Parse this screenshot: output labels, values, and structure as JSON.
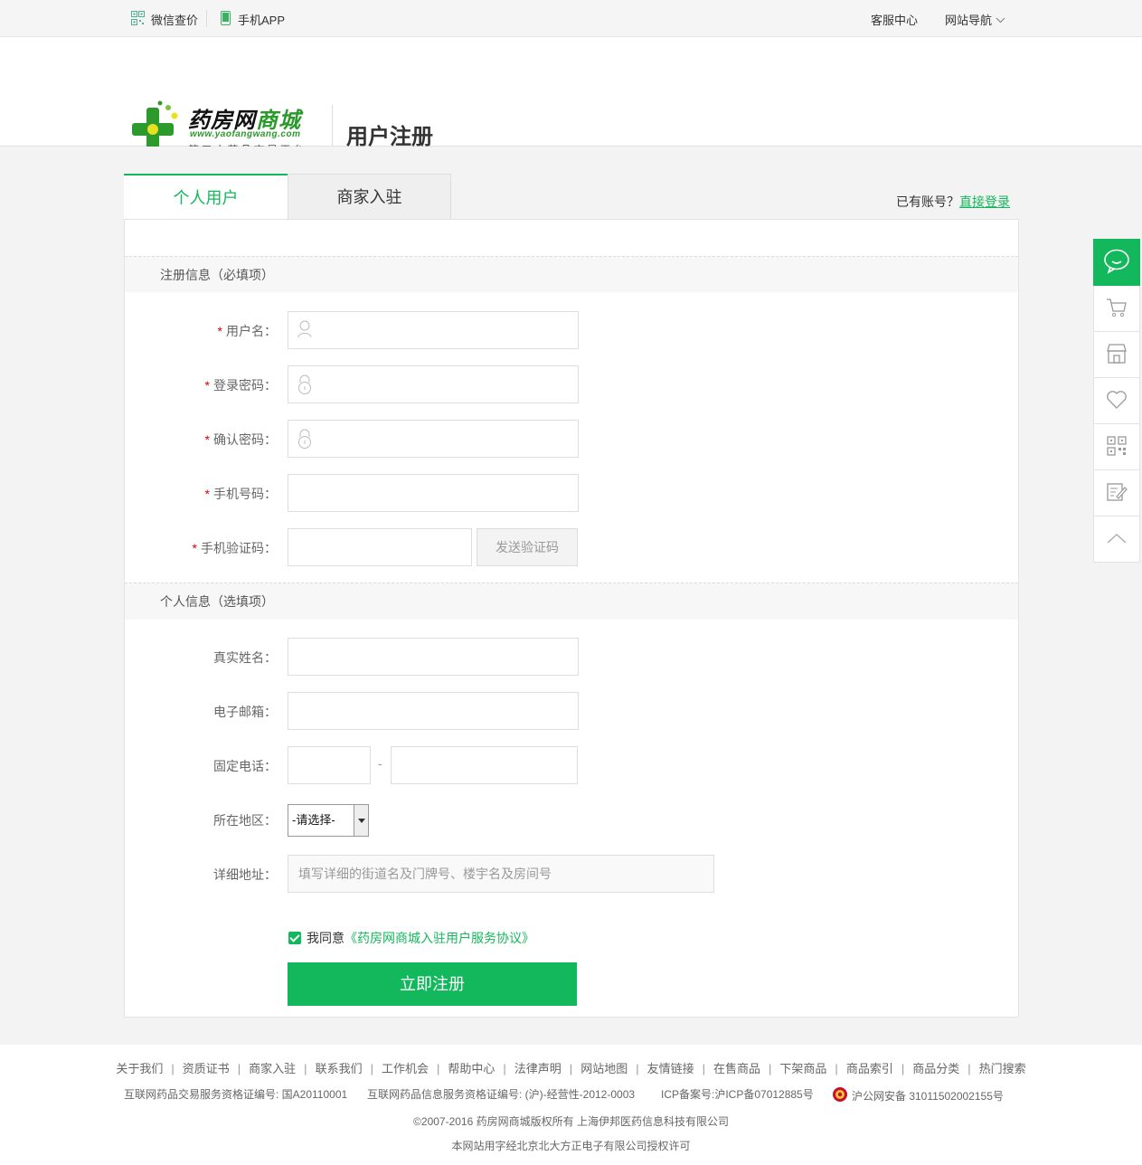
{
  "topbar": {
    "wechat_label": "微信查价",
    "app_label": "手机APP",
    "service_label": "客服中心",
    "nav_label": "网站导航"
  },
  "header": {
    "logo_name_black": "药房网",
    "logo_name_green": "商城",
    "logo_url": "www.yaofangwang.com",
    "logo_sub": "第三方药品交易平台",
    "title": "用户注册"
  },
  "tabs": {
    "personal": "个人用户",
    "merchant": "商家入驻"
  },
  "login_hint": {
    "text": "已有账号？",
    "link": "直接登录"
  },
  "required_section": {
    "title": "注册信息（必填项）",
    "star": "*",
    "username_label": "用户名：",
    "password_label": "登录密码：",
    "confirm_label": "确认密码：",
    "phone_label": "手机号码：",
    "code_label": "手机验证码：",
    "send_code": "发送验证码"
  },
  "optional_section": {
    "title": "个人信息（选填项）",
    "realname_label": "真实姓名：",
    "email_label": "电子邮箱：",
    "tel_label": "固定电话：",
    "tel_dash": "-",
    "region_label": "所在地区：",
    "region_value": "-请选择-",
    "address_label": "详细地址：",
    "address_placeholder": "填写详细的街道名及门牌号、楼宇名及房间号"
  },
  "agreement": {
    "checked": true,
    "prefix": "我同意",
    "link": "《药房网商城入驻用户服务协议》"
  },
  "submit_label": "立即注册",
  "sidebar_icons": [
    "chat-icon",
    "cart-icon",
    "shop-icon",
    "heart-icon",
    "qrcode-icon",
    "edit-icon",
    "back-to-top-icon"
  ],
  "footer": {
    "links": [
      "关于我们",
      "资质证书",
      "商家入驻",
      "联系我们",
      "工作机会",
      "帮助中心",
      "法律声明",
      "网站地图",
      "友情链接",
      "在售商品",
      "下架商品",
      "商品索引",
      "商品分类",
      "热门搜索"
    ],
    "license1": "互联网药品交易服务资格证编号: 国A20110001",
    "license2": "互联网药品信息服务资格证编号: (沪)-经营性-2012-0003",
    "icp": "ICP备案号:沪ICP备07012885号",
    "police": "沪公网安备 31011502002155号",
    "copyright": "©2007-2016 药房网商城版权所有 上海伊邦医药信息科技有限公司",
    "font_auth": "本网站用字经北京北大方正电子有限公司授权许可"
  },
  "colors": {
    "brand_green": "#13b75c",
    "required_star": "#dd0000"
  }
}
